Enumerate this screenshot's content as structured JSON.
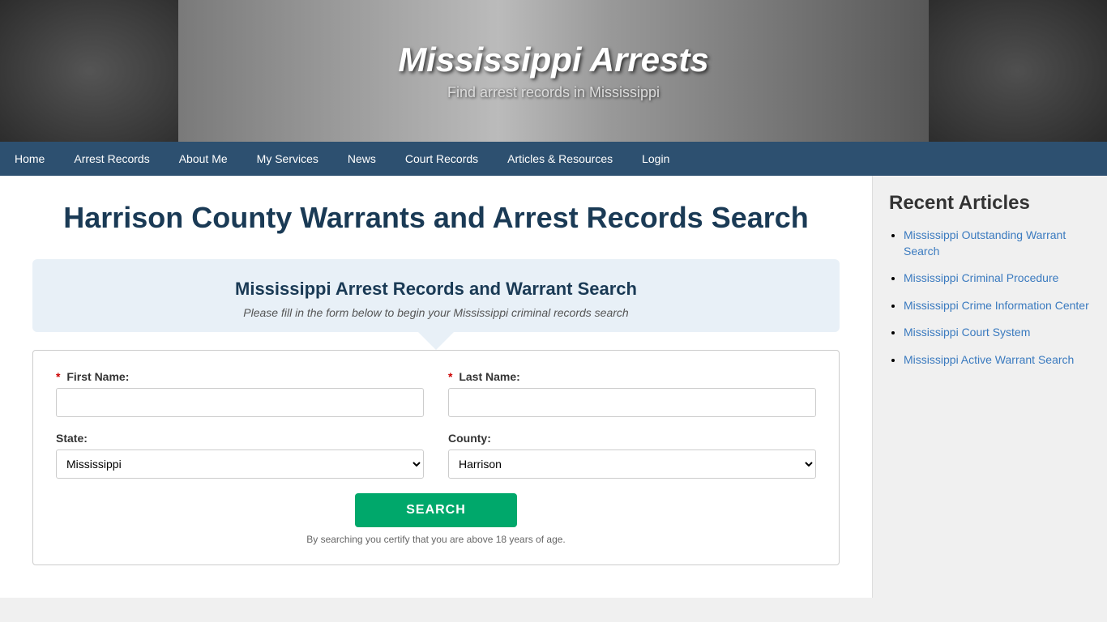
{
  "header": {
    "title": "Mississippi Arrests",
    "subtitle": "Find arrest records in Mississippi"
  },
  "nav": {
    "items": [
      {
        "label": "Home",
        "active": false
      },
      {
        "label": "Arrest Records",
        "active": false
      },
      {
        "label": "About Me",
        "active": false
      },
      {
        "label": "My Services",
        "active": false
      },
      {
        "label": "News",
        "active": false
      },
      {
        "label": "Court Records",
        "active": false
      },
      {
        "label": "Articles & Resources",
        "active": false
      },
      {
        "label": "Login",
        "active": false
      }
    ]
  },
  "main": {
    "page_heading": "Harrison County Warrants and Arrest Records Search",
    "search_box_title": "Mississippi Arrest Records and Warrant Search",
    "search_box_subtitle": "Please fill in the form below to begin your Mississippi criminal records search",
    "form": {
      "first_name_label": "First Name:",
      "last_name_label": "Last Name:",
      "state_label": "State:",
      "county_label": "County:",
      "state_value": "Mississippi",
      "county_value": "Harrison",
      "search_button_label": "SEARCH",
      "form_note": "By searching you certify that you are above 18 years of age.",
      "state_options": [
        "Mississippi"
      ],
      "county_options": [
        "Harrison"
      ]
    }
  },
  "sidebar": {
    "title": "Recent Articles",
    "articles": [
      {
        "label": "Mississippi Outstanding Warrant Search"
      },
      {
        "label": "Mississippi Criminal Procedure"
      },
      {
        "label": "Mississippi Crime Information Center"
      },
      {
        "label": "Mississippi Court System"
      },
      {
        "label": "Mississippi Active Warrant Search"
      }
    ]
  }
}
